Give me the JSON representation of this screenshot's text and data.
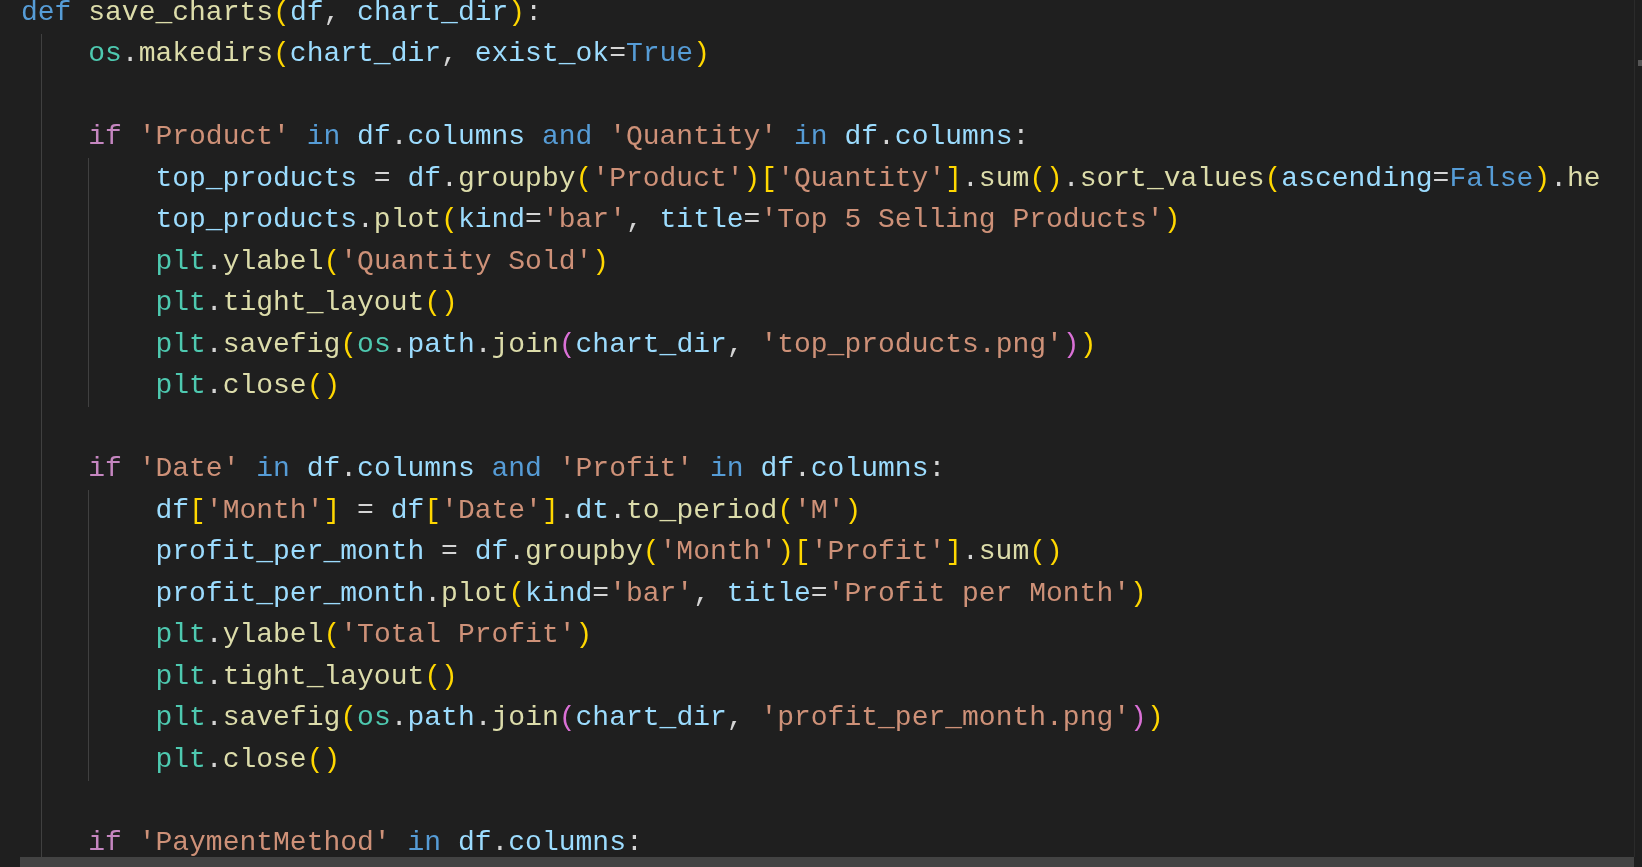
{
  "editor": {
    "lines": [
      {
        "kind": "code",
        "tokens": [
          {
            "text": "def ",
            "kind": "kw"
          },
          {
            "text": "save_charts",
            "kind": "fn"
          },
          {
            "text": "(",
            "kind": "p1"
          },
          {
            "text": "df",
            "kind": "var"
          },
          {
            "text": ", ",
            "kind": "op"
          },
          {
            "text": "chart_dir",
            "kind": "var"
          },
          {
            "text": ")",
            "kind": "p1"
          },
          {
            "text": ":",
            "kind": "op"
          }
        ],
        "children": [
          {
            "kind": "code",
            "tokens": [
              {
                "text": "os",
                "kind": "mod"
              },
              {
                "text": ".",
                "kind": "op"
              },
              {
                "text": "makedirs",
                "kind": "fn"
              },
              {
                "text": "(",
                "kind": "p1"
              },
              {
                "text": "chart_dir",
                "kind": "var"
              },
              {
                "text": ", ",
                "kind": "op"
              },
              {
                "text": "exist_ok",
                "kind": "var"
              },
              {
                "text": "=",
                "kind": "op"
              },
              {
                "text": "True",
                "kind": "kw"
              },
              {
                "text": ")",
                "kind": "p1"
              }
            ]
          },
          {
            "kind": "blank"
          },
          {
            "kind": "code",
            "tokens": [
              {
                "text": "if ",
                "kind": "ctl"
              },
              {
                "text": "'Product' ",
                "kind": "str"
              },
              {
                "text": "in ",
                "kind": "kw"
              },
              {
                "text": "df",
                "kind": "var"
              },
              {
                "text": ".",
                "kind": "op"
              },
              {
                "text": "columns ",
                "kind": "var"
              },
              {
                "text": "and ",
                "kind": "kw"
              },
              {
                "text": "'Quantity' ",
                "kind": "str"
              },
              {
                "text": "in ",
                "kind": "kw"
              },
              {
                "text": "df",
                "kind": "var"
              },
              {
                "text": ".",
                "kind": "op"
              },
              {
                "text": "columns",
                "kind": "var"
              },
              {
                "text": ":",
                "kind": "op"
              }
            ],
            "children": [
              {
                "kind": "code",
                "tokens": [
                  {
                    "text": "top_products",
                    "kind": "var"
                  },
                  {
                    "text": " = ",
                    "kind": "op"
                  },
                  {
                    "text": "df",
                    "kind": "var"
                  },
                  {
                    "text": ".",
                    "kind": "op"
                  },
                  {
                    "text": "groupby",
                    "kind": "fn"
                  },
                  {
                    "text": "(",
                    "kind": "p1"
                  },
                  {
                    "text": "'Product'",
                    "kind": "str"
                  },
                  {
                    "text": ")[",
                    "kind": "p1"
                  },
                  {
                    "text": "'Quantity'",
                    "kind": "str"
                  },
                  {
                    "text": "]",
                    "kind": "p1"
                  },
                  {
                    "text": ".",
                    "kind": "op"
                  },
                  {
                    "text": "sum",
                    "kind": "fn"
                  },
                  {
                    "text": "()",
                    "kind": "p1"
                  },
                  {
                    "text": ".",
                    "kind": "op"
                  },
                  {
                    "text": "sort_values",
                    "kind": "fn"
                  },
                  {
                    "text": "(",
                    "kind": "p1"
                  },
                  {
                    "text": "ascending",
                    "kind": "var"
                  },
                  {
                    "text": "=",
                    "kind": "op"
                  },
                  {
                    "text": "False",
                    "kind": "kw"
                  },
                  {
                    "text": ")",
                    "kind": "p1"
                  },
                  {
                    "text": ".",
                    "kind": "op"
                  },
                  {
                    "text": "he",
                    "kind": "fn"
                  }
                ]
              },
              {
                "kind": "code",
                "tokens": [
                  {
                    "text": "top_products",
                    "kind": "var"
                  },
                  {
                    "text": ".",
                    "kind": "op"
                  },
                  {
                    "text": "plot",
                    "kind": "fn"
                  },
                  {
                    "text": "(",
                    "kind": "p1"
                  },
                  {
                    "text": "kind",
                    "kind": "var"
                  },
                  {
                    "text": "=",
                    "kind": "op"
                  },
                  {
                    "text": "'bar'",
                    "kind": "str"
                  },
                  {
                    "text": ", ",
                    "kind": "op"
                  },
                  {
                    "text": "title",
                    "kind": "var"
                  },
                  {
                    "text": "=",
                    "kind": "op"
                  },
                  {
                    "text": "'Top 5 Selling Products'",
                    "kind": "str"
                  },
                  {
                    "text": ")",
                    "kind": "p1"
                  }
                ]
              },
              {
                "kind": "code",
                "tokens": [
                  {
                    "text": "plt",
                    "kind": "mod"
                  },
                  {
                    "text": ".",
                    "kind": "op"
                  },
                  {
                    "text": "ylabel",
                    "kind": "fn"
                  },
                  {
                    "text": "(",
                    "kind": "p1"
                  },
                  {
                    "text": "'Quantity Sold'",
                    "kind": "str"
                  },
                  {
                    "text": ")",
                    "kind": "p1"
                  }
                ]
              },
              {
                "kind": "code",
                "tokens": [
                  {
                    "text": "plt",
                    "kind": "mod"
                  },
                  {
                    "text": ".",
                    "kind": "op"
                  },
                  {
                    "text": "tight_layout",
                    "kind": "fn"
                  },
                  {
                    "text": "()",
                    "kind": "p1"
                  }
                ]
              },
              {
                "kind": "code",
                "tokens": [
                  {
                    "text": "plt",
                    "kind": "mod"
                  },
                  {
                    "text": ".",
                    "kind": "op"
                  },
                  {
                    "text": "savefig",
                    "kind": "fn"
                  },
                  {
                    "text": "(",
                    "kind": "p1"
                  },
                  {
                    "text": "os",
                    "kind": "mod"
                  },
                  {
                    "text": ".",
                    "kind": "op"
                  },
                  {
                    "text": "path",
                    "kind": "var"
                  },
                  {
                    "text": ".",
                    "kind": "op"
                  },
                  {
                    "text": "join",
                    "kind": "fn"
                  },
                  {
                    "text": "(",
                    "kind": "p2"
                  },
                  {
                    "text": "chart_dir",
                    "kind": "var"
                  },
                  {
                    "text": ", ",
                    "kind": "op"
                  },
                  {
                    "text": "'top_products.png'",
                    "kind": "str"
                  },
                  {
                    "text": ")",
                    "kind": "p2"
                  },
                  {
                    "text": ")",
                    "kind": "p1"
                  }
                ]
              },
              {
                "kind": "code",
                "tokens": [
                  {
                    "text": "plt",
                    "kind": "mod"
                  },
                  {
                    "text": ".",
                    "kind": "op"
                  },
                  {
                    "text": "close",
                    "kind": "fn"
                  },
                  {
                    "text": "()",
                    "kind": "p1"
                  }
                ]
              }
            ]
          },
          {
            "kind": "blank"
          },
          {
            "kind": "code",
            "tokens": [
              {
                "text": "if ",
                "kind": "ctl"
              },
              {
                "text": "'Date' ",
                "kind": "str"
              },
              {
                "text": "in ",
                "kind": "kw"
              },
              {
                "text": "df",
                "kind": "var"
              },
              {
                "text": ".",
                "kind": "op"
              },
              {
                "text": "columns ",
                "kind": "var"
              },
              {
                "text": "and ",
                "kind": "kw"
              },
              {
                "text": "'Profit' ",
                "kind": "str"
              },
              {
                "text": "in ",
                "kind": "kw"
              },
              {
                "text": "df",
                "kind": "var"
              },
              {
                "text": ".",
                "kind": "op"
              },
              {
                "text": "columns",
                "kind": "var"
              },
              {
                "text": ":",
                "kind": "op"
              }
            ],
            "children": [
              {
                "kind": "code",
                "tokens": [
                  {
                    "text": "df",
                    "kind": "var"
                  },
                  {
                    "text": "[",
                    "kind": "p1"
                  },
                  {
                    "text": "'Month'",
                    "kind": "str"
                  },
                  {
                    "text": "]",
                    "kind": "p1"
                  },
                  {
                    "text": " = ",
                    "kind": "op"
                  },
                  {
                    "text": "df",
                    "kind": "var"
                  },
                  {
                    "text": "[",
                    "kind": "p1"
                  },
                  {
                    "text": "'Date'",
                    "kind": "str"
                  },
                  {
                    "text": "]",
                    "kind": "p1"
                  },
                  {
                    "text": ".",
                    "kind": "op"
                  },
                  {
                    "text": "dt",
                    "kind": "var"
                  },
                  {
                    "text": ".",
                    "kind": "op"
                  },
                  {
                    "text": "to_period",
                    "kind": "fn"
                  },
                  {
                    "text": "(",
                    "kind": "p1"
                  },
                  {
                    "text": "'M'",
                    "kind": "str"
                  },
                  {
                    "text": ")",
                    "kind": "p1"
                  }
                ]
              },
              {
                "kind": "code",
                "tokens": [
                  {
                    "text": "profit_per_month",
                    "kind": "var"
                  },
                  {
                    "text": " = ",
                    "kind": "op"
                  },
                  {
                    "text": "df",
                    "kind": "var"
                  },
                  {
                    "text": ".",
                    "kind": "op"
                  },
                  {
                    "text": "groupby",
                    "kind": "fn"
                  },
                  {
                    "text": "(",
                    "kind": "p1"
                  },
                  {
                    "text": "'Month'",
                    "kind": "str"
                  },
                  {
                    "text": ")[",
                    "kind": "p1"
                  },
                  {
                    "text": "'Profit'",
                    "kind": "str"
                  },
                  {
                    "text": "]",
                    "kind": "p1"
                  },
                  {
                    "text": ".",
                    "kind": "op"
                  },
                  {
                    "text": "sum",
                    "kind": "fn"
                  },
                  {
                    "text": "()",
                    "kind": "p1"
                  }
                ]
              },
              {
                "kind": "code",
                "tokens": [
                  {
                    "text": "profit_per_month",
                    "kind": "var"
                  },
                  {
                    "text": ".",
                    "kind": "op"
                  },
                  {
                    "text": "plot",
                    "kind": "fn"
                  },
                  {
                    "text": "(",
                    "kind": "p1"
                  },
                  {
                    "text": "kind",
                    "kind": "var"
                  },
                  {
                    "text": "=",
                    "kind": "op"
                  },
                  {
                    "text": "'bar'",
                    "kind": "str"
                  },
                  {
                    "text": ", ",
                    "kind": "op"
                  },
                  {
                    "text": "title",
                    "kind": "var"
                  },
                  {
                    "text": "=",
                    "kind": "op"
                  },
                  {
                    "text": "'Profit per Month'",
                    "kind": "str"
                  },
                  {
                    "text": ")",
                    "kind": "p1"
                  }
                ]
              },
              {
                "kind": "code",
                "tokens": [
                  {
                    "text": "plt",
                    "kind": "mod"
                  },
                  {
                    "text": ".",
                    "kind": "op"
                  },
                  {
                    "text": "ylabel",
                    "kind": "fn"
                  },
                  {
                    "text": "(",
                    "kind": "p1"
                  },
                  {
                    "text": "'Total Profit'",
                    "kind": "str"
                  },
                  {
                    "text": ")",
                    "kind": "p1"
                  }
                ]
              },
              {
                "kind": "code",
                "tokens": [
                  {
                    "text": "plt",
                    "kind": "mod"
                  },
                  {
                    "text": ".",
                    "kind": "op"
                  },
                  {
                    "text": "tight_layout",
                    "kind": "fn"
                  },
                  {
                    "text": "()",
                    "kind": "p1"
                  }
                ]
              },
              {
                "kind": "code",
                "tokens": [
                  {
                    "text": "plt",
                    "kind": "mod"
                  },
                  {
                    "text": ".",
                    "kind": "op"
                  },
                  {
                    "text": "savefig",
                    "kind": "fn"
                  },
                  {
                    "text": "(",
                    "kind": "p1"
                  },
                  {
                    "text": "os",
                    "kind": "mod"
                  },
                  {
                    "text": ".",
                    "kind": "op"
                  },
                  {
                    "text": "path",
                    "kind": "var"
                  },
                  {
                    "text": ".",
                    "kind": "op"
                  },
                  {
                    "text": "join",
                    "kind": "fn"
                  },
                  {
                    "text": "(",
                    "kind": "p2"
                  },
                  {
                    "text": "chart_dir",
                    "kind": "var"
                  },
                  {
                    "text": ", ",
                    "kind": "op"
                  },
                  {
                    "text": "'profit_per_month.png'",
                    "kind": "str"
                  },
                  {
                    "text": ")",
                    "kind": "p2"
                  },
                  {
                    "text": ")",
                    "kind": "p1"
                  }
                ]
              },
              {
                "kind": "code",
                "tokens": [
                  {
                    "text": "plt",
                    "kind": "mod"
                  },
                  {
                    "text": ".",
                    "kind": "op"
                  },
                  {
                    "text": "close",
                    "kind": "fn"
                  },
                  {
                    "text": "()",
                    "kind": "p1"
                  }
                ]
              }
            ]
          },
          {
            "kind": "blank"
          },
          {
            "kind": "code",
            "tokens": [
              {
                "text": "if ",
                "kind": "ctl"
              },
              {
                "text": "'PaymentMethod' ",
                "kind": "str"
              },
              {
                "text": "in ",
                "kind": "kw"
              },
              {
                "text": "df",
                "kind": "var"
              },
              {
                "text": ".",
                "kind": "op"
              },
              {
                "text": "columns",
                "kind": "var"
              },
              {
                "text": ":",
                "kind": "op"
              }
            ]
          }
        ]
      }
    ]
  }
}
